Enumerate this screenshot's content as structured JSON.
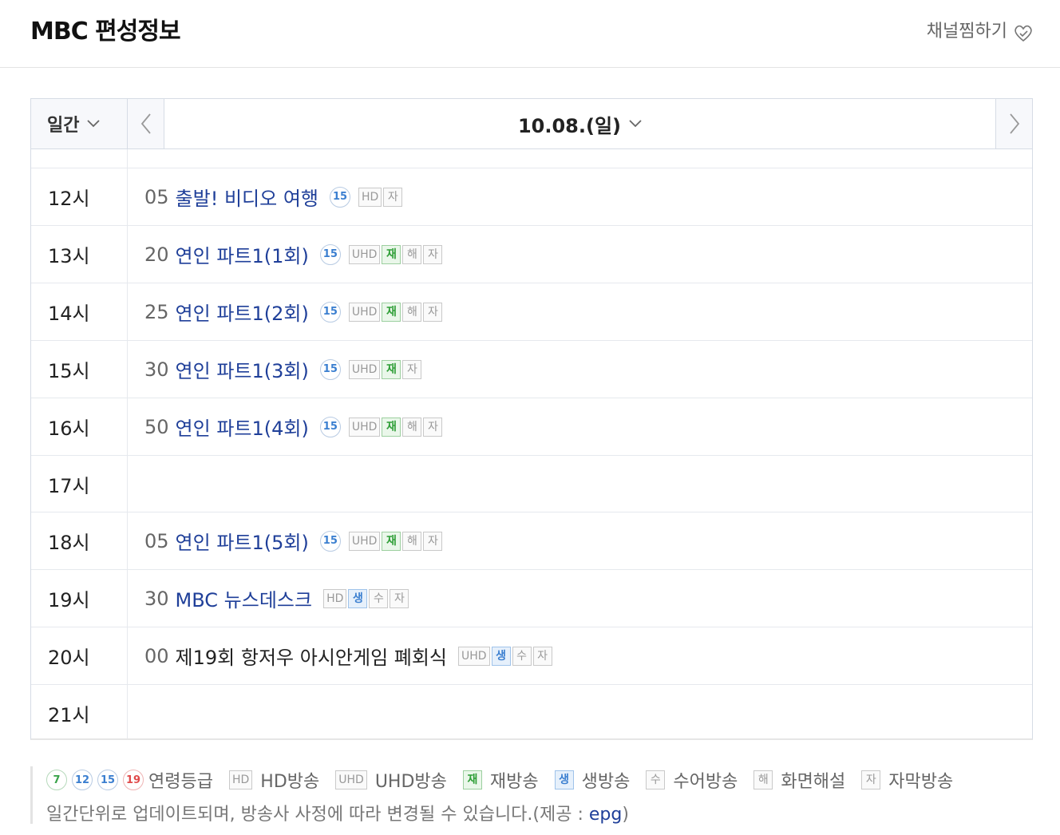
{
  "header": {
    "title": "MBC 편성정보",
    "favorite_label": "채널찜하기"
  },
  "topbar": {
    "period_label": "일간",
    "date_label": "10.08.(일)"
  },
  "schedule": [
    {
      "hour": "12시",
      "min": "05",
      "name": "출발! 비디오 여행",
      "age": "15",
      "badges": [
        {
          "text": "HD",
          "type": "plain"
        },
        {
          "text": "자",
          "type": "plain"
        }
      ]
    },
    {
      "hour": "13시",
      "min": "20",
      "name": "연인 파트1(1회)",
      "age": "15",
      "badges": [
        {
          "text": "UHD",
          "type": "plain"
        },
        {
          "text": "재",
          "type": "re"
        },
        {
          "text": "해",
          "type": "plain"
        },
        {
          "text": "자",
          "type": "plain"
        }
      ]
    },
    {
      "hour": "14시",
      "min": "25",
      "name": "연인 파트1(2회)",
      "age": "15",
      "badges": [
        {
          "text": "UHD",
          "type": "plain"
        },
        {
          "text": "재",
          "type": "re"
        },
        {
          "text": "해",
          "type": "plain"
        },
        {
          "text": "자",
          "type": "plain"
        }
      ]
    },
    {
      "hour": "15시",
      "min": "30",
      "name": "연인 파트1(3회)",
      "age": "15",
      "badges": [
        {
          "text": "UHD",
          "type": "plain"
        },
        {
          "text": "재",
          "type": "re"
        },
        {
          "text": "자",
          "type": "plain"
        }
      ]
    },
    {
      "hour": "16시",
      "min": "50",
      "name": "연인 파트1(4회)",
      "age": "15",
      "badges": [
        {
          "text": "UHD",
          "type": "plain"
        },
        {
          "text": "재",
          "type": "re"
        },
        {
          "text": "해",
          "type": "plain"
        },
        {
          "text": "자",
          "type": "plain"
        }
      ]
    },
    {
      "hour": "17시",
      "min": "",
      "name": "",
      "age": "",
      "badges": []
    },
    {
      "hour": "18시",
      "min": "05",
      "name": "연인 파트1(5회)",
      "age": "15",
      "badges": [
        {
          "text": "UHD",
          "type": "plain"
        },
        {
          "text": "재",
          "type": "re"
        },
        {
          "text": "해",
          "type": "plain"
        },
        {
          "text": "자",
          "type": "plain"
        }
      ]
    },
    {
      "hour": "19시",
      "min": "30",
      "name": "MBC 뉴스데스크",
      "age": "",
      "badges": [
        {
          "text": "HD",
          "type": "plain"
        },
        {
          "text": "생",
          "type": "live"
        },
        {
          "text": "수",
          "type": "plain"
        },
        {
          "text": "자",
          "type": "plain"
        }
      ]
    },
    {
      "hour": "20시",
      "min": "00",
      "name": "제19회 항저우 아시안게임 폐회식",
      "age": "",
      "plain": true,
      "badges": [
        {
          "text": "UHD",
          "type": "plain"
        },
        {
          "text": "생",
          "type": "live"
        },
        {
          "text": "수",
          "type": "plain"
        },
        {
          "text": "자",
          "type": "plain"
        }
      ]
    },
    {
      "hour": "21시",
      "min": "",
      "name": "",
      "age": "",
      "badges": []
    }
  ],
  "legend": {
    "ages": [
      "7",
      "12",
      "15",
      "19"
    ],
    "age_label": "연령등급",
    "items": [
      {
        "badge": "HD",
        "type": "plain",
        "label": "HD방송"
      },
      {
        "badge": "UHD",
        "type": "plain",
        "label": "UHD방송"
      },
      {
        "badge": "재",
        "type": "re",
        "label": "재방송"
      },
      {
        "badge": "생",
        "type": "live",
        "label": "생방송"
      },
      {
        "badge": "수",
        "type": "plain",
        "label": "수어방송"
      },
      {
        "badge": "해",
        "type": "plain",
        "label": "화면해설"
      },
      {
        "badge": "자",
        "type": "plain",
        "label": "자막방송"
      }
    ],
    "note": "일간단위로 업데이트되며, 방송사 사정에 따라 변경될 수 있습니다.(제공 : ",
    "source": "epg",
    "note_end": ")"
  }
}
